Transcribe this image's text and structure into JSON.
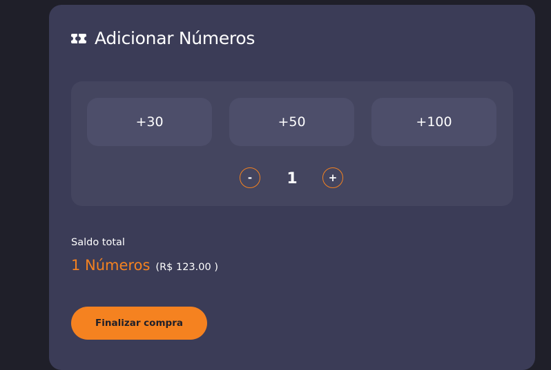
{
  "header": {
    "icon": "ticket-icon",
    "title": "Adicionar Números"
  },
  "quick_add": {
    "options": [
      "+30",
      "+50",
      "+100"
    ]
  },
  "stepper": {
    "minus_label": "-",
    "value": "1",
    "plus_label": "+"
  },
  "summary": {
    "label": "Saldo total",
    "count": "1 Números",
    "price": "(R$ 123.00 )"
  },
  "actions": {
    "finalize_label": "Finalizar compra"
  },
  "colors": {
    "page_background": "#1f1f29",
    "card_background": "#3b3c57",
    "accent": "#f58220"
  }
}
